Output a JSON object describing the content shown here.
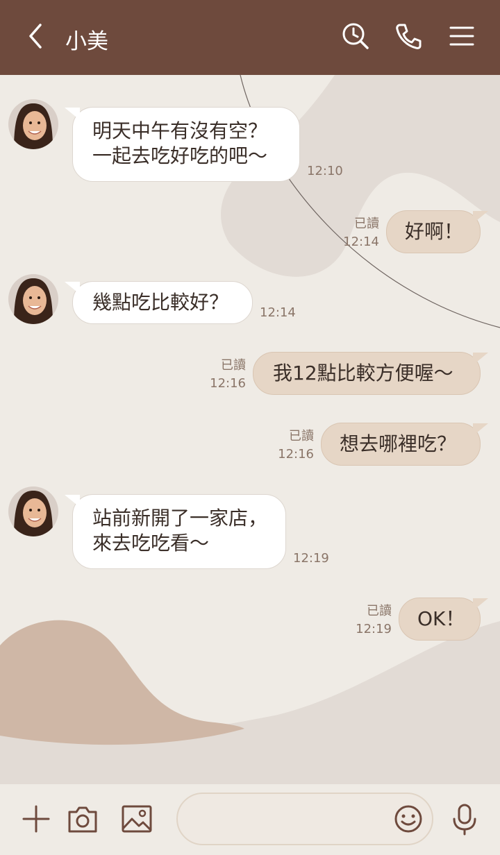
{
  "header": {
    "title": "小美"
  },
  "messages": [
    {
      "text": "明天中午有沒有空？\n一起去吃好吃的吧～",
      "time": "12:10"
    },
    {
      "text": "好啊！",
      "status": "已讀",
      "time": "12:14"
    },
    {
      "text": "幾點吃比較好？",
      "time": "12:14"
    },
    {
      "text": "我12點比較方便喔～",
      "status": "已讀",
      "time": "12:16"
    },
    {
      "text": "想去哪裡吃？",
      "status": "已讀",
      "time": "12:16"
    },
    {
      "text": "站前新開了一家店，\n來去吃吃看～",
      "time": "12:19"
    },
    {
      "text": "OK！",
      "status": "已讀",
      "time": "12:19"
    }
  ],
  "composer": {
    "placeholder": ""
  },
  "icons": {
    "header": [
      "back-icon",
      "search-icon",
      "phone-icon",
      "menu-icon"
    ],
    "footer": [
      "plus-icon",
      "camera-icon",
      "image-icon",
      "emoji-icon",
      "mic-icon"
    ]
  },
  "colors": {
    "header": "#6e4a3d",
    "background": "#efebe5",
    "incoming_bubble": "#ffffff",
    "outgoing_bubble": "#e6d6c6",
    "meta_text": "#8a7568"
  }
}
